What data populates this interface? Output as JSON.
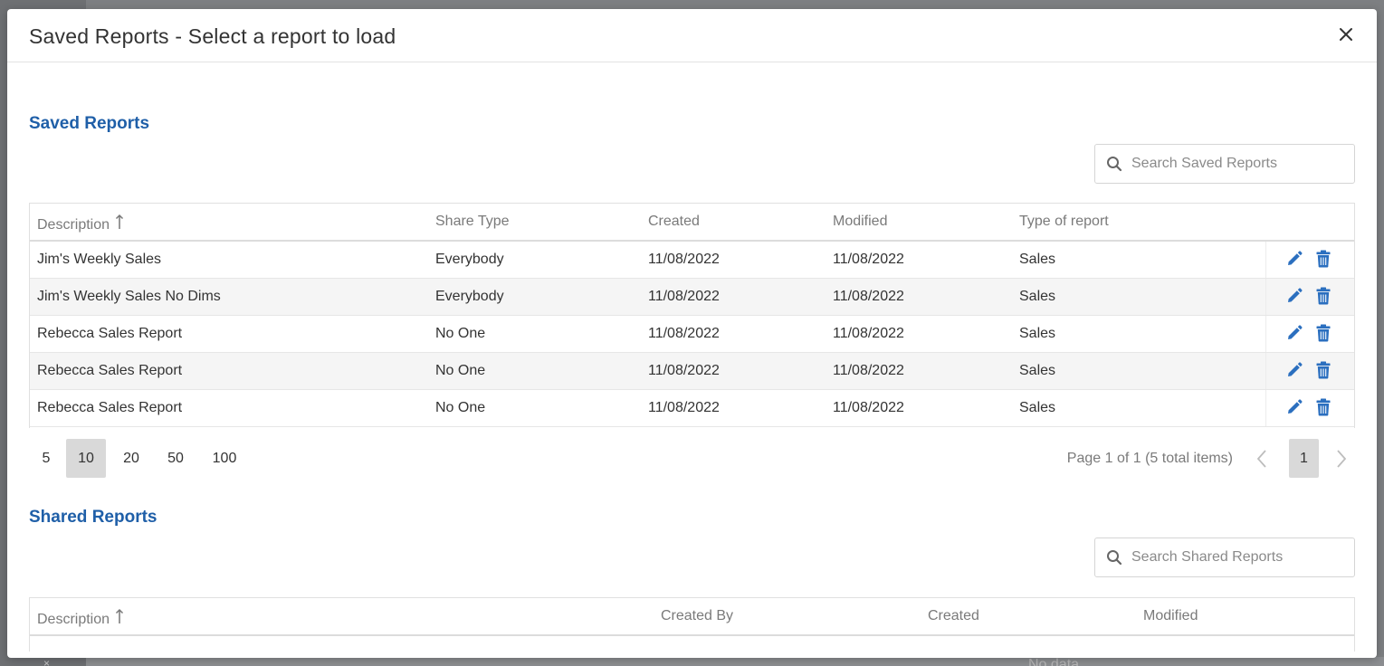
{
  "modal": {
    "title": "Saved Reports - Select a report to load"
  },
  "saved": {
    "section_title": "Saved Reports",
    "search_placeholder": "Search Saved Reports",
    "columns": {
      "description": "Description",
      "share_type": "Share Type",
      "created": "Created",
      "modified": "Modified",
      "type": "Type of report"
    },
    "rows": [
      {
        "description": "Jim's Weekly Sales",
        "share_type": "Everybody",
        "created": "11/08/2022",
        "modified": "11/08/2022",
        "type": "Sales"
      },
      {
        "description": "Jim's Weekly Sales No Dims",
        "share_type": "Everybody",
        "created": "11/08/2022",
        "modified": "11/08/2022",
        "type": "Sales"
      },
      {
        "description": "Rebecca Sales Report",
        "share_type": "No One",
        "created": "11/08/2022",
        "modified": "11/08/2022",
        "type": "Sales"
      },
      {
        "description": "Rebecca Sales Report",
        "share_type": "No One",
        "created": "11/08/2022",
        "modified": "11/08/2022",
        "type": "Sales"
      },
      {
        "description": "Rebecca Sales Report",
        "share_type": "No One",
        "created": "11/08/2022",
        "modified": "11/08/2022",
        "type": "Sales"
      }
    ],
    "pager": {
      "page_sizes": [
        "5",
        "10",
        "20",
        "50",
        "100"
      ],
      "active_page_size": "10",
      "info": "Page 1 of 1 (5 total items)",
      "current_page": "1"
    }
  },
  "shared": {
    "section_title": "Shared Reports",
    "search_placeholder": "Search Shared Reports",
    "columns": {
      "description": "Description",
      "created_by": "Created By",
      "created": "Created",
      "modified": "Modified"
    }
  },
  "background": {
    "no_data": "No data",
    "close_mark": "×"
  },
  "colors": {
    "accent": "#1f5fa8",
    "icon_blue": "#2b6fbf",
    "active_bg": "#d9d9d9"
  },
  "icons": {
    "close": "close-icon",
    "search": "search-icon",
    "sort": "sort-ascending-icon",
    "edit": "pencil-icon",
    "delete": "trash-icon",
    "prev": "chevron-left-icon",
    "next": "chevron-right-icon"
  }
}
